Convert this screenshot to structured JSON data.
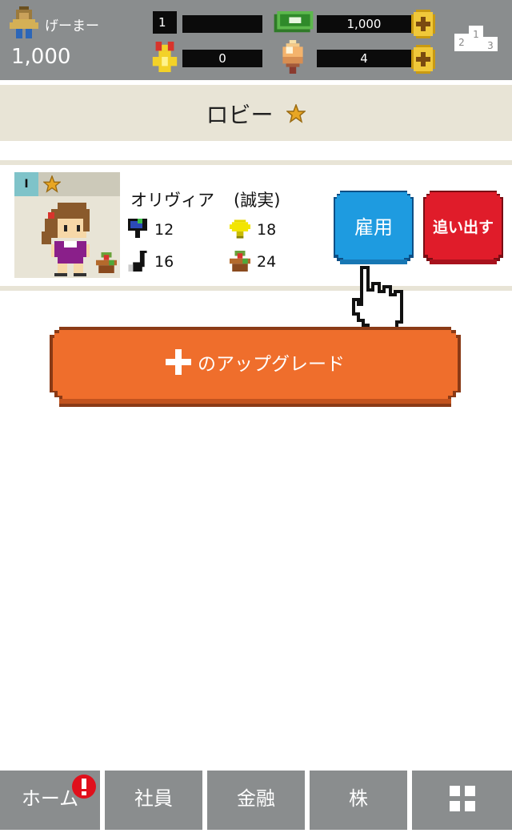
{
  "header": {
    "player_name": "げーまー",
    "player_money": "1,000",
    "rank": "1",
    "cash": "1,000",
    "medals": "0",
    "gems": "4",
    "podium_labels": [
      "2",
      "1",
      "3"
    ]
  },
  "title": {
    "text": "ロビー"
  },
  "employee": {
    "level": "I",
    "name": "オリヴィア",
    "trait": "(誠実)",
    "stats": {
      "stat1": "12",
      "stat2": "18",
      "stat3": "16",
      "stat4": "24"
    }
  },
  "buttons": {
    "hire": "雇用",
    "fire": "追い出す",
    "upgrade": "のアップグレード"
  },
  "nav": {
    "home": "ホーム",
    "staff": "社員",
    "finance": "金融",
    "stocks": "株"
  },
  "colors": {
    "header": "#8a8d8e",
    "beige": "#e8e4d6",
    "hire_blue": "#1e9be0",
    "fire_red": "#e01c2a",
    "upgrade_orange": "#ef6e2c"
  }
}
